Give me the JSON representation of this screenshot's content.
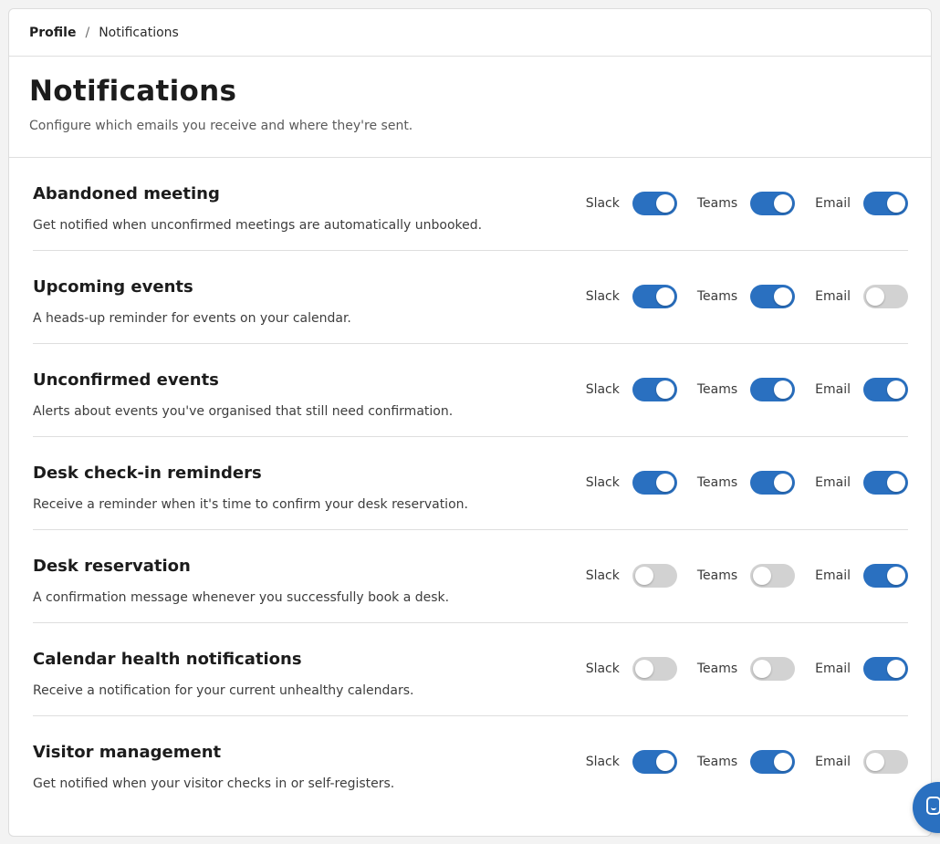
{
  "breadcrumb": {
    "parent": "Profile",
    "separator": "/",
    "current": "Notifications"
  },
  "header": {
    "title": "Notifications",
    "subtitle": "Configure which emails you receive and where they're sent."
  },
  "channel_labels": {
    "slack": "Slack",
    "teams": "Teams",
    "email": "Email"
  },
  "colors": {
    "toggle_on": "#2a70c0",
    "toggle_off": "#d2d2d2"
  },
  "notifications": [
    {
      "title": "Abandoned meeting",
      "description": "Get notified when unconfirmed meetings are automatically unbooked.",
      "slack": true,
      "teams": true,
      "email": true
    },
    {
      "title": "Upcoming events",
      "description": "A heads-up reminder for events on your calendar.",
      "slack": true,
      "teams": true,
      "email": false
    },
    {
      "title": "Unconfirmed events",
      "description": "Alerts about events you've organised that still need confirmation.",
      "slack": true,
      "teams": true,
      "email": true
    },
    {
      "title": "Desk check-in reminders",
      "description": "Receive a reminder when it's time to confirm your desk reservation.",
      "slack": true,
      "teams": true,
      "email": true
    },
    {
      "title": "Desk reservation",
      "description": "A confirmation message whenever you successfully book a desk.",
      "slack": false,
      "teams": false,
      "email": true
    },
    {
      "title": "Calendar health notifications",
      "description": "Receive a notification for your current unhealthy calendars.",
      "slack": false,
      "teams": false,
      "email": true
    },
    {
      "title": "Visitor management",
      "description": "Get notified when your visitor checks in or self-registers.",
      "slack": true,
      "teams": true,
      "email": false
    }
  ],
  "chat_launcher": {
    "icon": "chat-icon"
  }
}
